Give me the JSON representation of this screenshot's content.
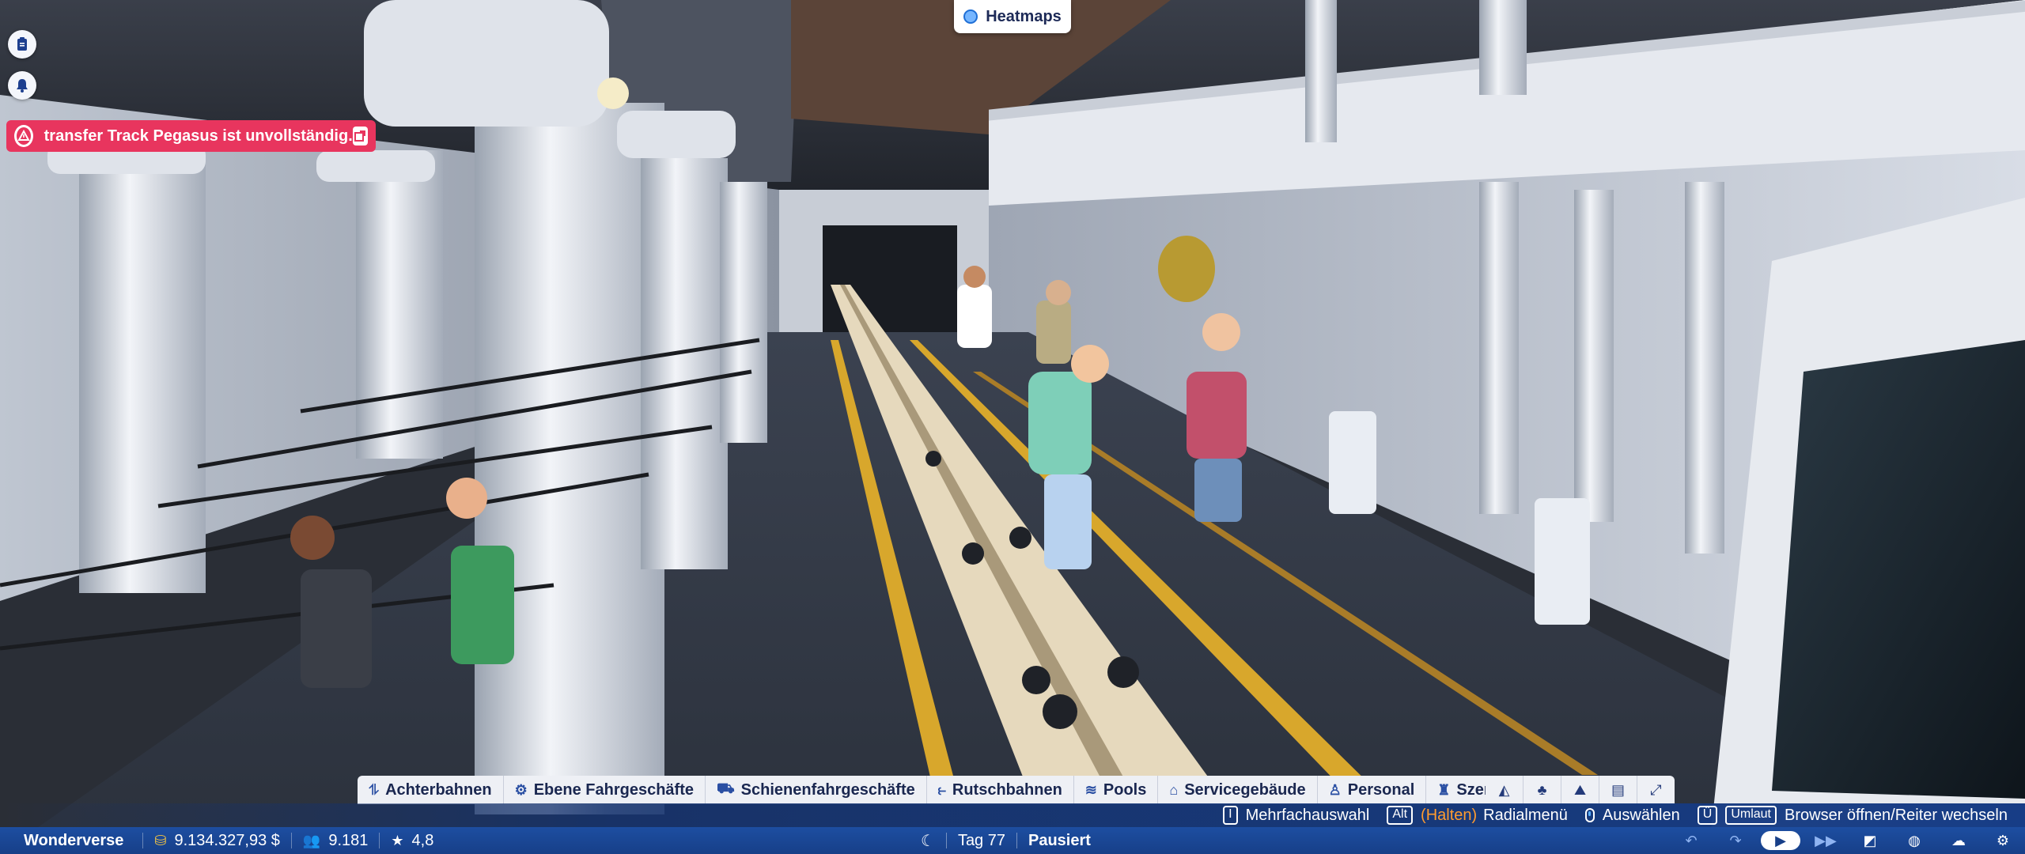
{
  "top": {
    "heatmaps_label": "Heatmaps"
  },
  "notification": {
    "message": "transfer Track Pegasus ist unvollständig."
  },
  "side_buttons": [
    "clipboard-icon",
    "bell-icon"
  ],
  "categories": [
    {
      "icon": "coaster-icon",
      "label": "Achterbahnen"
    },
    {
      "icon": "flat-ride-icon",
      "label": "Ebene Fahrgeschäfte"
    },
    {
      "icon": "track-ride-icon",
      "label": "Schienenfahrgeschäfte"
    },
    {
      "icon": "slide-icon",
      "label": "Rutschbahnen"
    },
    {
      "icon": "pool-icon",
      "label": "Pools"
    },
    {
      "icon": "service-building-icon",
      "label": "Servicegebäude"
    },
    {
      "icon": "staff-icon",
      "label": "Personal"
    },
    {
      "icon": "scenery-icon",
      "label": "Szenerie"
    }
  ],
  "tools": [
    "path-tool-icon",
    "tree-tool-icon",
    "terrain-tool-icon",
    "blueprint-tool-icon",
    "fullscreen-icon"
  ],
  "hints": {
    "multi_key": "I",
    "multi_label": "Mehrfachauswahl",
    "alt_key": "Alt",
    "hold_label": "(Halten)",
    "radial_label": "Radialmenü",
    "select_label": "Auswählen",
    "u_key": "Ü",
    "umlaut_key": "Umlaut",
    "browser_label": "Browser öffnen/Reiter wechseln"
  },
  "status": {
    "park_name": "Wonderverse",
    "money": "9.134.327,93 $",
    "guests": "9.181",
    "rating": "4,8",
    "day": "Tag 77",
    "paused": "Pausiert"
  },
  "colors": {
    "accent_blue": "#173f88",
    "alert_red": "#e8355e",
    "highlight_orange": "#ff9b2f"
  }
}
